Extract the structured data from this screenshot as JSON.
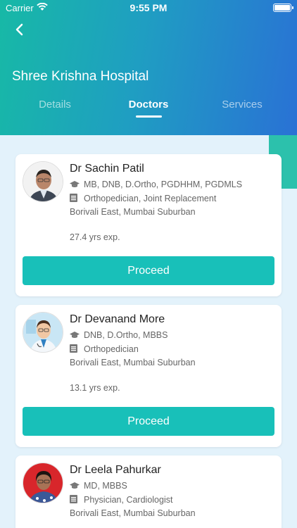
{
  "status": {
    "carrier": "Carrier",
    "time": "9:55 PM"
  },
  "header": {
    "title": "Shree Krishna Hospital"
  },
  "tabs": [
    {
      "label": "Details"
    },
    {
      "label": "Doctors"
    },
    {
      "label": "Services"
    }
  ],
  "doctors": [
    {
      "name": "Dr Sachin Patil",
      "qualification": "MB, DNB, D.Ortho, PGDHHM, PGDMLS",
      "speciality": "Orthopedician, Joint Replacement",
      "location": "Borivali East, Mumbai Suburban",
      "experience": "27.4 yrs exp.",
      "action": "Proceed"
    },
    {
      "name": "Dr Devanand More",
      "qualification": "DNB, D.Ortho, MBBS",
      "speciality": "Orthopedician",
      "location": "Borivali East, Mumbai Suburban",
      "experience": "13.1 yrs exp.",
      "action": "Proceed"
    },
    {
      "name": "Dr Leela Pahurkar",
      "qualification": "MD, MBBS",
      "speciality": "Physician, Cardiologist",
      "location": "Borivali East, Mumbai Suburban"
    }
  ],
  "colors": {
    "accent": "#18c0b9",
    "header_start": "#17b9a6",
    "header_end": "#2a6fd6",
    "background": "#e3f2fb"
  }
}
